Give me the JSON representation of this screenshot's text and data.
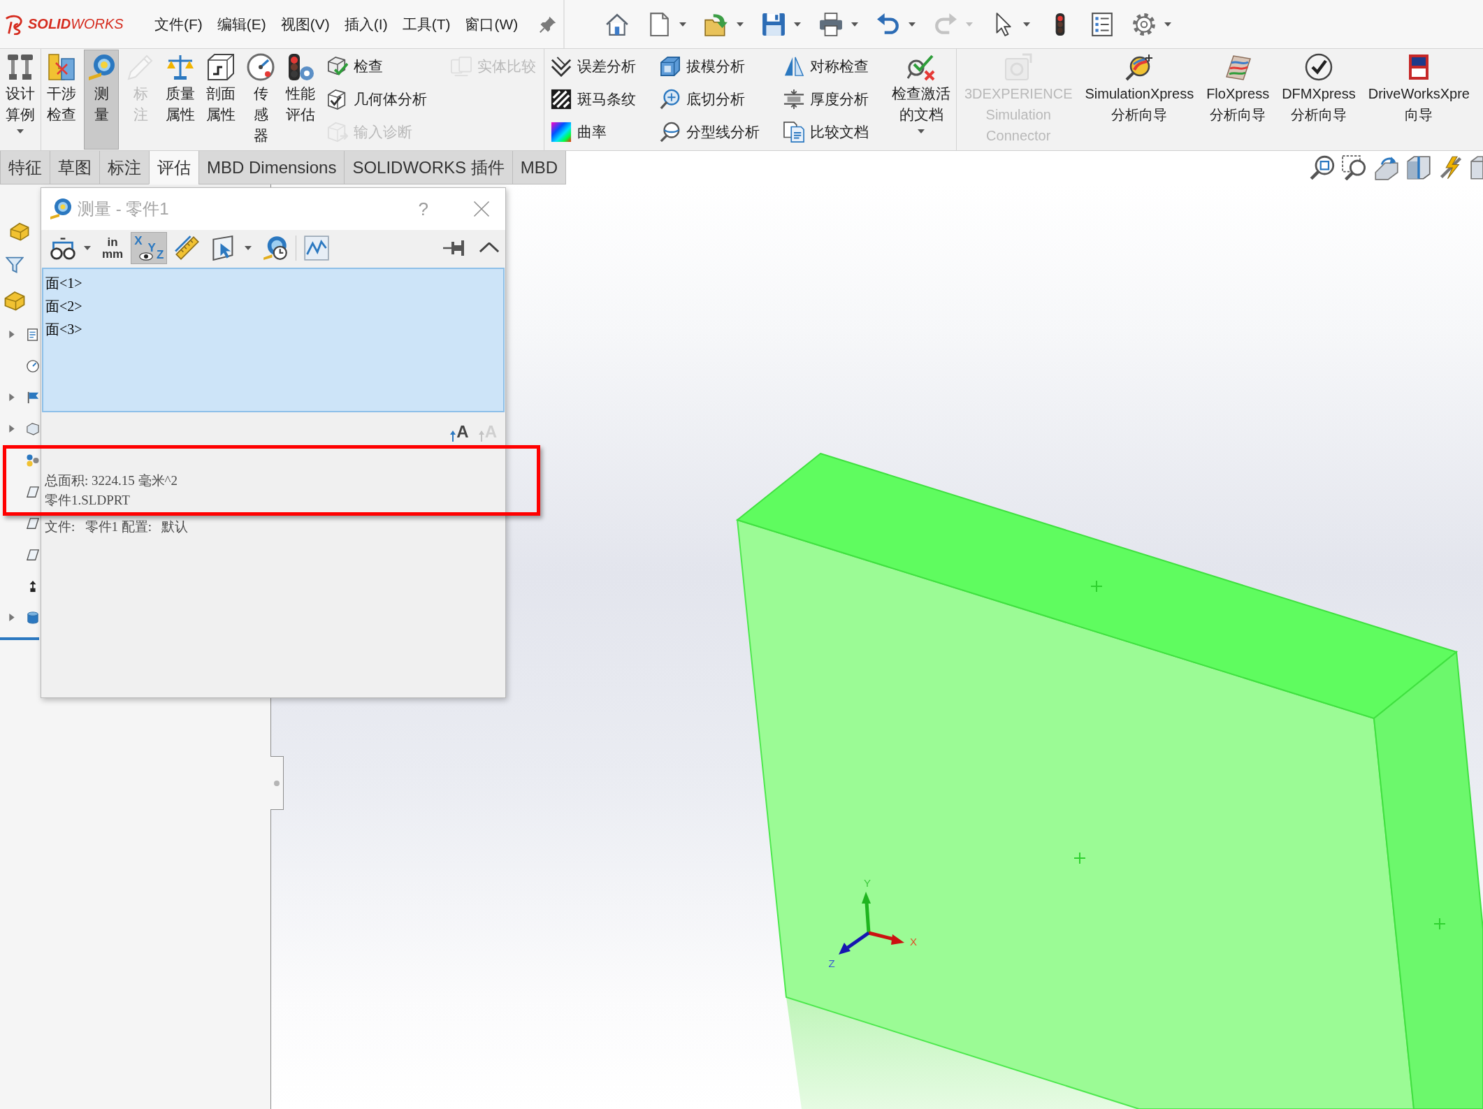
{
  "title_bar": {
    "logo": "**SOLID**WORKS",
    "menu": [
      "文件(F)",
      "编辑(E)",
      "视图(V)",
      "插入(I)",
      "工具(T)",
      "窗口(W)"
    ],
    "quick_access": [
      {
        "menu": false,
        "disabled": false
      },
      {
        "menu": true,
        "disabled": false
      },
      {
        "menu": true,
        "disabled": false
      },
      {
        "menu": true,
        "disabled": false
      },
      {
        "menu": true,
        "disabled": false
      },
      {
        "menu": true,
        "disabled": false
      },
      {
        "menu": true,
        "disabled": true
      },
      {
        "menu": true,
        "disabled": false
      },
      {
        "menu": false,
        "disabled": false
      },
      {
        "menu": false,
        "disabled": false
      },
      {
        "menu": true,
        "disabled": false
      }
    ]
  },
  "ribbon": {
    "groups": [
      {
        "items": [
          {
            "kind": "large",
            "label": [
              "设计",
              "算例"
            ],
            "selected": false,
            "disabled": false,
            "menu": true
          }
        ]
      },
      {
        "items": [
          {
            "kind": "large",
            "label": [
              "干涉",
              "检查"
            ],
            "selected": false,
            "disabled": false,
            "menu": false
          },
          {
            "kind": "large",
            "label": [
              "测",
              "量"
            ],
            "selected": true,
            "disabled": false,
            "menu": false
          },
          {
            "kind": "large",
            "label": [
              "标",
              "注"
            ],
            "selected": false,
            "disabled": true,
            "menu": false
          },
          {
            "kind": "large",
            "label": [
              "质量",
              "属性"
            ],
            "selected": false,
            "disabled": false,
            "menu": false
          },
          {
            "kind": "large",
            "label": [
              "剖面",
              "属性"
            ],
            "selected": false,
            "disabled": false,
            "menu": false
          },
          {
            "kind": "large",
            "label": [
              "传",
              "感",
              "器"
            ],
            "selected": false,
            "disabled": false,
            "menu": false
          },
          {
            "kind": "large",
            "label": [
              "性能",
              "评估"
            ],
            "selected": false,
            "disabled": false,
            "menu": false
          },
          {
            "kind": "column",
            "entries": [
              {
                "label": "检查",
                "selected": false,
                "disabled": false
              },
              {
                "label": "几何体分析",
                "selected": false,
                "disabled": false
              },
              {
                "label": "输入诊断",
                "selected": false,
                "disabled": true
              }
            ]
          },
          {
            "kind": "column",
            "entries": [
              {
                "label": "实体比较",
                "selected": false,
                "disabled": true
              }
            ]
          }
        ]
      },
      {
        "items": [
          {
            "kind": "column",
            "entries": [
              {
                "label": "误差分析",
                "selected": false,
                "disabled": false
              },
              {
                "label": "斑马条纹",
                "selected": false,
                "disabled": false
              },
              {
                "label": "曲率",
                "selected": false,
                "disabled": false
              }
            ]
          },
          {
            "kind": "column",
            "entries": [
              {
                "label": "拔模分析",
                "selected": false,
                "disabled": false
              },
              {
                "label": "底切分析",
                "selected": false,
                "disabled": false
              },
              {
                "label": "分型线分析",
                "selected": false,
                "disabled": false
              }
            ]
          },
          {
            "kind": "column",
            "entries": [
              {
                "label": "对称检查",
                "selected": false,
                "disabled": false
              },
              {
                "label": "厚度分析",
                "selected": false,
                "disabled": false
              },
              {
                "label": "比较文档",
                "selected": false,
                "disabled": false
              }
            ]
          },
          {
            "kind": "large",
            "label": [
              "检查激活",
              "的文档"
            ],
            "selected": false,
            "disabled": false,
            "menu": true
          }
        ]
      },
      {
        "items": [
          {
            "kind": "large",
            "label": [
              "3DEXPERIENCE",
              "Simulation",
              "Connector"
            ],
            "selected": false,
            "disabled": true,
            "menu": false
          },
          {
            "kind": "large",
            "label": [
              "SimulationXpress",
              "分析向导"
            ],
            "selected": false,
            "disabled": false,
            "menu": false
          },
          {
            "kind": "large",
            "label": [
              "FloXpress",
              "分析向导"
            ],
            "selected": false,
            "disabled": false,
            "menu": false
          },
          {
            "kind": "large",
            "label": [
              "DFMXpress",
              "分析向导"
            ],
            "selected": false,
            "disabled": false,
            "menu": false
          },
          {
            "kind": "large",
            "label": [
              "DriveWorksXpre",
              "向导"
            ],
            "selected": false,
            "disabled": false,
            "menu": false
          }
        ]
      }
    ]
  },
  "command_tabs": [
    {
      "label": "特征",
      "selected": false
    },
    {
      "label": "草图",
      "selected": false
    },
    {
      "label": "标注",
      "selected": false
    },
    {
      "label": "评估",
      "selected": true
    },
    {
      "label": "MBD Dimensions",
      "selected": false
    },
    {
      "label": "SOLIDWORKS 插件",
      "selected": false
    },
    {
      "label": "MBD",
      "selected": false
    }
  ],
  "feature_tree": {
    "rows": [
      {
        "expandable": true,
        "expanded": false
      },
      {
        "expandable": false,
        "expanded": false
      },
      {
        "expandable": true,
        "expanded": false
      },
      {
        "expandable": true,
        "expanded": false
      },
      {
        "expandable": false,
        "expanded": false
      },
      {
        "expandable": false,
        "expanded": false
      },
      {
        "expandable": false,
        "expanded": false
      },
      {
        "expandable": false,
        "expanded": false
      },
      {
        "expandable": false,
        "expanded": false
      },
      {
        "expandable": true,
        "expanded": false
      }
    ]
  },
  "measure_dialog": {
    "title": "测量 - 零件1",
    "active": false,
    "help": "?",
    "toolbar": [
      {
        "kind": "icon",
        "selected": false,
        "menu": true
      },
      {
        "kind": "units",
        "lines": [
          "in",
          "mm"
        ],
        "selected": false,
        "menu": false
      },
      {
        "kind": "xyz",
        "letters": [
          "X",
          "Y",
          "Z"
        ],
        "selected": true,
        "menu": false
      },
      {
        "kind": "icon",
        "selected": false,
        "menu": false
      },
      {
        "kind": "icon",
        "selected": false,
        "menu": true
      },
      {
        "kind": "icon",
        "selected": false,
        "menu": false
      },
      {
        "kind": "icon",
        "selected": false,
        "menu": false
      }
    ],
    "selections": [
      "面<1>",
      "面<2>",
      "面<3>"
    ],
    "font_buttons": [
      {
        "glyph": "A",
        "disabled": false
      },
      {
        "glyph": "A",
        "disabled": true
      }
    ],
    "results": [
      "总面积: 3224.15 毫米^2",
      "零件1.SLDPRT",
      "文件:   零件1 配置:   默认"
    ]
  },
  "viewport": {
    "triad": {
      "x": "X",
      "y": "Y",
      "z": "Z"
    }
  }
}
